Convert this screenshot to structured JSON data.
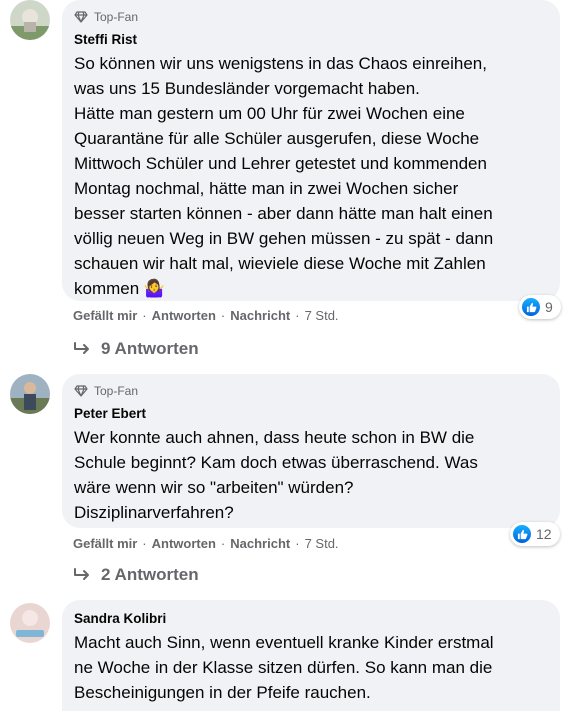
{
  "comments": [
    {
      "badge": "Top-Fan",
      "author": "Steffi Rist",
      "text": "So können wir uns wenigstens in das Chaos einreihen,\nwas uns 15 Bundesländer vorgemacht haben.\nHätte man gestern um 00 Uhr für zwei Wochen eine\nQuarantäne für alle Schüler ausgerufen, diese Woche\nMittwoch Schüler und Lehrer getestet und kommenden\nMontag nochmal, hätte man in zwei Wochen sicher\nbesser starten können - aber dann hätte man halt einen\nvöllig neuen Weg in BW gehen müssen - zu spät - dann\nschauen wir halt mal, wieviele diese Woche mit Zahlen\nkommen 🤷‍♀️",
      "reaction_count": "9",
      "actions": {
        "like": "Gefällt mir",
        "reply": "Antworten",
        "message": "Nachricht",
        "time": "7 Std."
      },
      "replies_label": "9 Antworten"
    },
    {
      "badge": "Top-Fan",
      "author": "Peter Ebert",
      "text": "Wer konnte auch ahnen, dass heute schon in BW die\nSchule beginnt? Kam doch etwas überraschend. Was\nwäre wenn wir so \"arbeiten\" würden?\nDisziplinarverfahren?",
      "reaction_count": "12",
      "actions": {
        "like": "Gefällt mir",
        "reply": "Antworten",
        "message": "Nachricht",
        "time": "7 Std."
      },
      "replies_label": "2 Antworten"
    },
    {
      "author": "Sandra Kolibri",
      "text": "Macht auch Sinn, wenn eventuell kranke Kinder erstmal\nne Woche in der Klasse sitzen dürfen. So kann man die\nBescheinigungen in der Pfeife rauchen."
    }
  ],
  "separator": "·",
  "colors": {
    "bubble": "#f0f2f5",
    "secondary_text": "#65676b",
    "like_blue": "#1877f2"
  },
  "icons": {
    "badge": "diamond-icon",
    "like": "thumbs-up-icon",
    "reply": "reply-arrow-icon"
  }
}
